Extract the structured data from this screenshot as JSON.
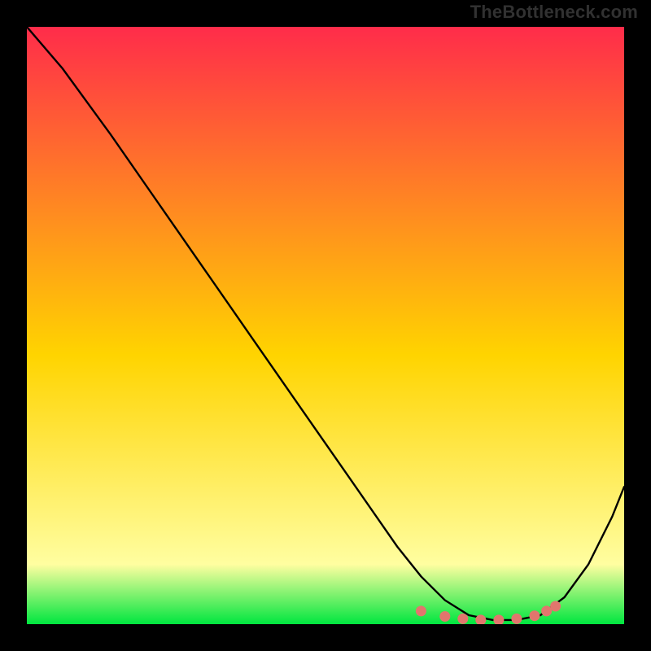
{
  "watermark": "TheBottleneck.com",
  "colors": {
    "frame": "#000000",
    "gradient_top": "#ff2c4a",
    "gradient_mid": "#ffd400",
    "gradient_low": "#fffea0",
    "gradient_bottom": "#00e63f",
    "curve": "#000000",
    "marker": "#e2766d"
  },
  "chart_data": {
    "type": "line",
    "title": "",
    "xlabel": "",
    "ylabel": "",
    "xlim": [
      0,
      100
    ],
    "ylim": [
      0,
      100
    ],
    "series": [
      {
        "name": "bottleneck-curve",
        "x": [
          0,
          6,
          14,
          22,
          30,
          38,
          46,
          54,
          62,
          66,
          70,
          74,
          78,
          82,
          86,
          90,
          94,
          98,
          100
        ],
        "y": [
          100,
          93,
          82,
          70.5,
          59,
          47.5,
          36,
          24.5,
          13,
          8,
          4,
          1.5,
          0.7,
          0.7,
          1.5,
          4.5,
          10,
          18,
          23
        ]
      }
    ],
    "markers": {
      "name": "highlighted-range",
      "points": [
        {
          "x": 66,
          "y": 2.2
        },
        {
          "x": 70,
          "y": 1.3
        },
        {
          "x": 73,
          "y": 0.9
        },
        {
          "x": 76,
          "y": 0.7
        },
        {
          "x": 79,
          "y": 0.7
        },
        {
          "x": 82,
          "y": 0.9
        },
        {
          "x": 85,
          "y": 1.4
        },
        {
          "x": 87,
          "y": 2.2
        },
        {
          "x": 88.5,
          "y": 3.0
        }
      ]
    }
  }
}
